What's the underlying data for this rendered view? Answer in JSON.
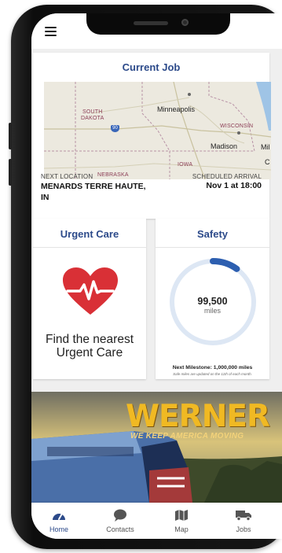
{
  "header": {
    "menu_icon": "hamburger-icon"
  },
  "current_job": {
    "title": "Current Job",
    "map_labels": {
      "south_dakota": "SOUTH\nDAKOTA",
      "minneapolis": "Minneapolis",
      "wisconsin": "WISCONSIN",
      "madison": "Madison",
      "mil": "Mil",
      "iowa": "IOWA",
      "nebraska": "NEBRASKA",
      "interstate": "90",
      "c": "C"
    },
    "next_location_label": "NEXT LOCATION",
    "next_location": "MENARDS TERRE HAUTE, IN",
    "scheduled_arrival_label": "SCHEDULED ARRIVAL",
    "scheduled_arrival": "Nov 1 at 18:00"
  },
  "urgent_care": {
    "title": "Urgent Care",
    "icon": "heartbeat-icon",
    "text": "Find the nearest Urgent Care",
    "color": "#d93036"
  },
  "safety": {
    "title": "Safety",
    "miles_value": "99,500",
    "miles_unit": "miles",
    "progress_fraction": 0.0995,
    "milestone": "Next Milestone: 1,000,000 miles",
    "footnote": "Safe miles are updated on the 11th of each month.",
    "ring_color": "#dde7f4",
    "progress_color": "#2d5fb0"
  },
  "banner": {
    "brand": "WERNER",
    "tagline": "WE KEEP AMERICA MOVING"
  },
  "bottom_nav": {
    "items": [
      {
        "label": "Home",
        "icon": "dashboard-icon",
        "active": true
      },
      {
        "label": "Contacts",
        "icon": "chat-icon",
        "active": false
      },
      {
        "label": "Map",
        "icon": "map-icon",
        "active": false
      },
      {
        "label": "Jobs",
        "icon": "truck-icon",
        "active": false
      }
    ],
    "active_color": "#2c4a8a"
  }
}
